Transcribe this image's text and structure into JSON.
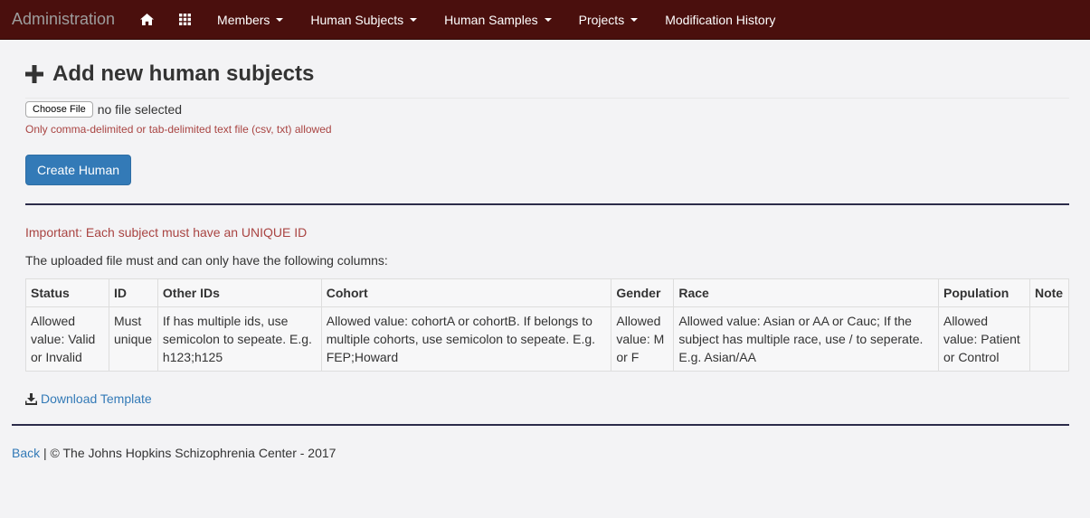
{
  "navbar": {
    "brand": "Administration",
    "items": [
      {
        "label": "Members",
        "dropdown": true
      },
      {
        "label": "Human Subjects",
        "dropdown": true
      },
      {
        "label": "Human Samples",
        "dropdown": true
      },
      {
        "label": "Projects",
        "dropdown": true
      },
      {
        "label": "Modification History",
        "dropdown": false
      }
    ],
    "icons": [
      "home-icon",
      "apps-grid-icon"
    ],
    "bg_color": "#4a0f0d"
  },
  "page": {
    "title": "Add new human subjects",
    "title_icon": "plus-icon",
    "file_input": {
      "button_label": "Choose File",
      "status": "no file selected",
      "help": "Only comma-delimited or tab-delimited text file (csv, txt) allowed"
    },
    "create_button": "Create Human",
    "important": "Important: Each subject must have an UNIQUE ID",
    "columns_intro": "The uploaded file must and can only have the following columns:",
    "table": {
      "headers": [
        "Status",
        "ID",
        "Other IDs",
        "Cohort",
        "Gender",
        "Race",
        "Population",
        "Note"
      ],
      "row": [
        "Allowed value: Valid or Invalid",
        "Must unique",
        "If has multiple ids, use semicolon to sepeate. E.g. h123;h125",
        "Allowed value: cohortA or cohortB. If belongs to multiple cohorts, use semicolon to sepeate. E.g. FEP;Howard",
        "Allowed value: M or F",
        "Allowed value: Asian or AA or Cauc; If the subject has multiple race, use / to seperate. E.g. Asian/AA",
        "Allowed value: Patient or Control",
        ""
      ]
    },
    "download_link": "Download Template",
    "download_icon": "download-icon"
  },
  "footer": {
    "back_link": "Back",
    "text": "| © The Johns Hopkins Schizophrenia Center - 2017"
  },
  "colors": {
    "accent": "#337ab7",
    "error": "#a94442"
  }
}
